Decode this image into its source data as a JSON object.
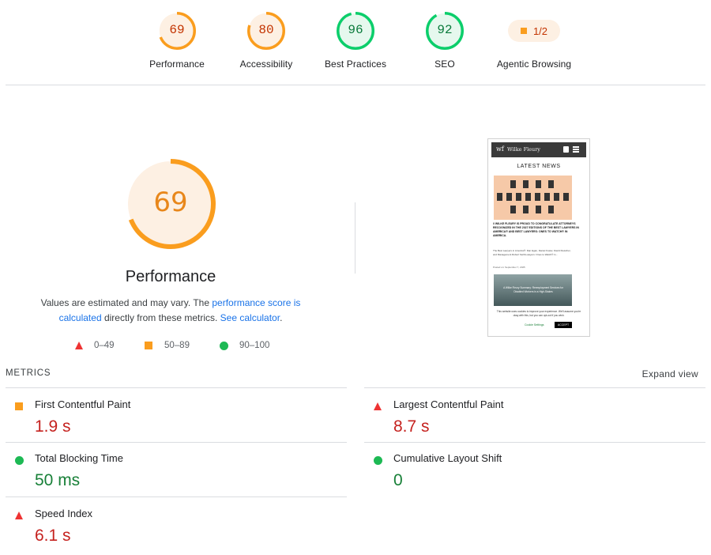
{
  "scores": [
    {
      "label": "Performance",
      "score": "69",
      "value": 69,
      "color": "#fa9d1e",
      "bg": "#fdf0e3",
      "text": "#c33300"
    },
    {
      "label": "Accessibility",
      "score": "80",
      "value": 80,
      "color": "#fa9d1e",
      "bg": "#fdf0e3",
      "text": "#c33300"
    },
    {
      "label": "Best Practices",
      "score": "96",
      "value": 96,
      "color": "#0cce6b",
      "bg": "#e6f8ee",
      "text": "#0a7a3b"
    },
    {
      "label": "SEO",
      "score": "92",
      "value": 92,
      "color": "#0cce6b",
      "bg": "#e6f8ee",
      "text": "#0a7a3b"
    }
  ],
  "agentic": {
    "label": "Agentic Browsing",
    "value": "1/2"
  },
  "performance": {
    "score": "69",
    "value": 69,
    "title": "Performance",
    "desc_1": "Values are estimated and may vary. The ",
    "desc_link_1": "performance score is calculated",
    "desc_2": " directly from these metrics. ",
    "desc_link_2": "See calculator",
    "desc_3": "."
  },
  "legend": [
    {
      "range": "0–49",
      "icon": "triangle-icon",
      "color": "#e33"
    },
    {
      "range": "50–89",
      "icon": "square-icon",
      "color": "#fa9d1e"
    },
    {
      "range": "90–100",
      "icon": "circle-icon",
      "color": "#0cce6b"
    }
  ],
  "thumbnail": {
    "brand": "Wilke Fleury",
    "heading": "LATEST NEWS",
    "headline": "// WILKE FLEURY IS PROUD TO CONGRATULATE ATTORNEYS RECOGNIZED IN THE 2027 EDITIONS OF THE BEST LAWYERS IN AMERICA® AND BEST LAWYERS: ONES TO WATCH® IN AMERICA.",
    "body": "The Best Lawyers in America®: Dan Egan, Daniel Foster, David Fleischer, and Management Robert Swift-Lawyers: Ones to Watch® in...",
    "posted": "Posted on: September 7, 2025",
    "banner": "A Wilke Fleury Summary: Reemployment Services for Disabled Workers in a High-Stakes",
    "cookie": "This website uses cookies to improve your experience. We'll assume you're okay with this, but you can opt-out if you wish.",
    "cookie_settings": "Cookie Settings",
    "accept": "ACCEPT"
  },
  "metrics": {
    "title": "METRICS",
    "expand": "Expand view",
    "items": [
      {
        "name": "First Contentful Paint",
        "value": "1.9 s",
        "status": "average"
      },
      {
        "name": "Largest Contentful Paint",
        "value": "8.7 s",
        "status": "fail"
      },
      {
        "name": "Total Blocking Time",
        "value": "50 ms",
        "status": "pass"
      },
      {
        "name": "Cumulative Layout Shift",
        "value": "0",
        "status": "pass"
      },
      {
        "name": "Speed Index",
        "value": "6.1 s",
        "status": "fail"
      }
    ]
  }
}
